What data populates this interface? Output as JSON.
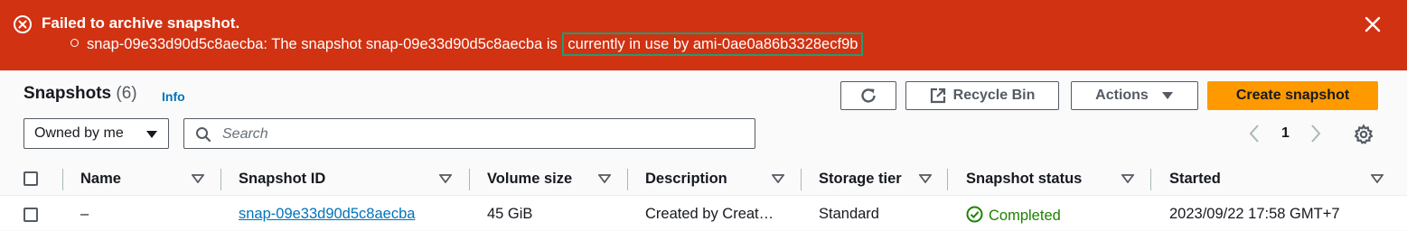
{
  "banner": {
    "title": "Failed to archive snapshot.",
    "message_prefix": "snap-09e33d90d5c8aecba: The snapshot snap-09e33d90d5c8aecba is",
    "message_highlight": "currently in use by ami-0ae0a86b3328ecf9b",
    "bg_color": "#d13212",
    "icon": "error-circle-x-icon",
    "close_icon": "close-x-icon"
  },
  "header": {
    "title": "Snapshots",
    "count": "(6)",
    "info_label": "Info"
  },
  "toolbar": {
    "refresh_icon": "refresh-icon",
    "recycle_bin_label": "Recycle Bin",
    "recycle_bin_icon": "external-link-icon",
    "actions_label": "Actions",
    "create_label": "Create snapshot",
    "primary_color": "#ff9900"
  },
  "filter": {
    "selected": "Owned by me",
    "search_placeholder": "Search"
  },
  "pagination": {
    "current_page": "1"
  },
  "table": {
    "columns": [
      "Name",
      "Snapshot ID",
      "Volume size",
      "Description",
      "Storage tier",
      "Snapshot status",
      "Started"
    ],
    "rows": [
      {
        "name": "–",
        "snapshot_id": "snap-09e33d90d5c8aecba",
        "volume_size": "45 GiB",
        "description": "Created by Creat…",
        "storage_tier": "Standard",
        "status": "Completed",
        "started": "2023/09/22 17:58 GMT+7"
      }
    ]
  }
}
